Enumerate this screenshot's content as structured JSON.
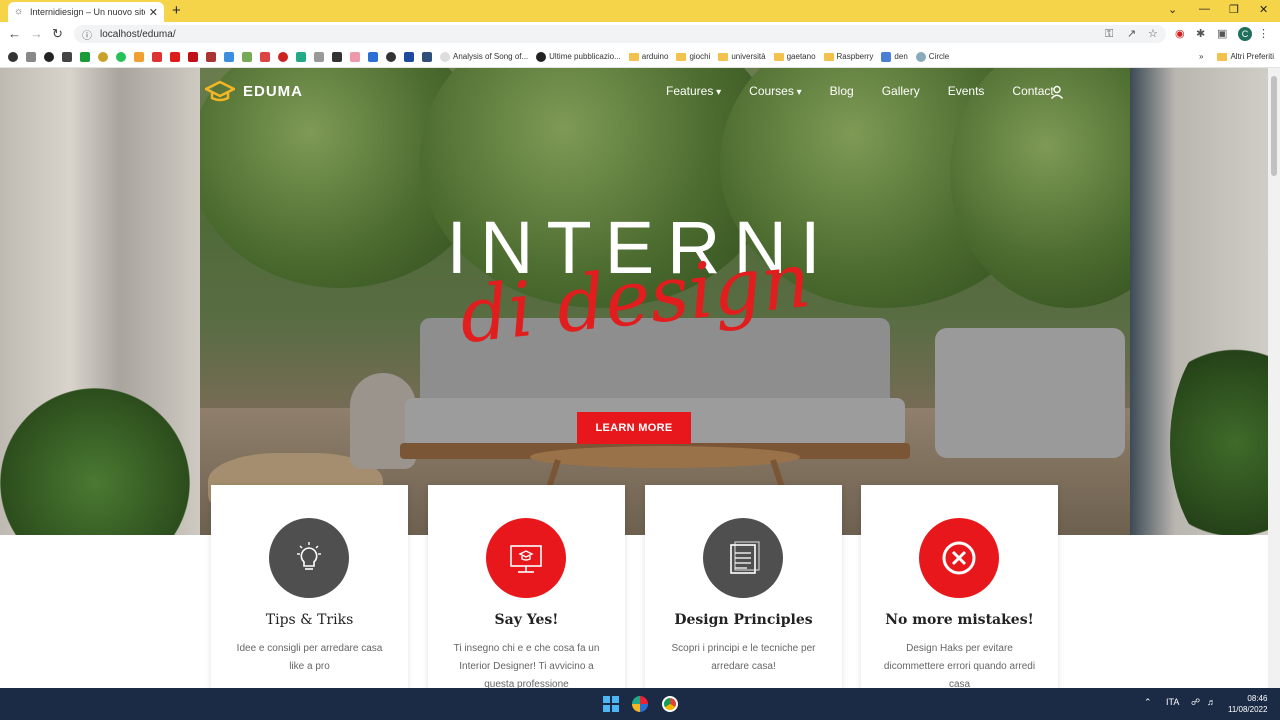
{
  "browser": {
    "tab_title": "Internidiesign – Un nuovo sito",
    "url": "localhost/eduma/",
    "profile_initial": "C",
    "bookmarks": [
      "Analysis of Song of...",
      "Ultime pubblicazio...",
      "arduino",
      "giochi",
      "università",
      "gaetano",
      "Raspberry",
      "den",
      "Circle"
    ],
    "other_bookmarks": "Altri Preferiti"
  },
  "site": {
    "logo_text": "EDUMA",
    "nav": [
      "Features",
      "Courses",
      "Blog",
      "Gallery",
      "Events",
      "Contact"
    ],
    "hero_title": "INTERNI",
    "hero_script": "di design",
    "cta_label": "LEARN MORE"
  },
  "cards": [
    {
      "title": "Tips & Triks",
      "desc": "Idee e consigli per arredare casa like a pro",
      "icon": "lightbulb-icon",
      "color": "#4f4f4f"
    },
    {
      "title": "Say Yes!",
      "desc": "Ti insegno chi e e che cosa fa un Interior Designer! Ti avvicino a questa professione",
      "icon": "presentation-icon",
      "color": "#e8171b"
    },
    {
      "title": "Design Principles",
      "desc": "Scopri i principi e le tecniche per arredare casa!",
      "icon": "notepad-icon",
      "color": "#4f4f4f"
    },
    {
      "title": "No more mistakes!",
      "desc": "Design Haks per evitare dicommettere errori quando arredi casa",
      "icon": "cancel-icon",
      "color": "#e8171b"
    }
  ],
  "taskbar": {
    "lang": "ITA",
    "time": "08:46",
    "date": "11/08/2022"
  }
}
